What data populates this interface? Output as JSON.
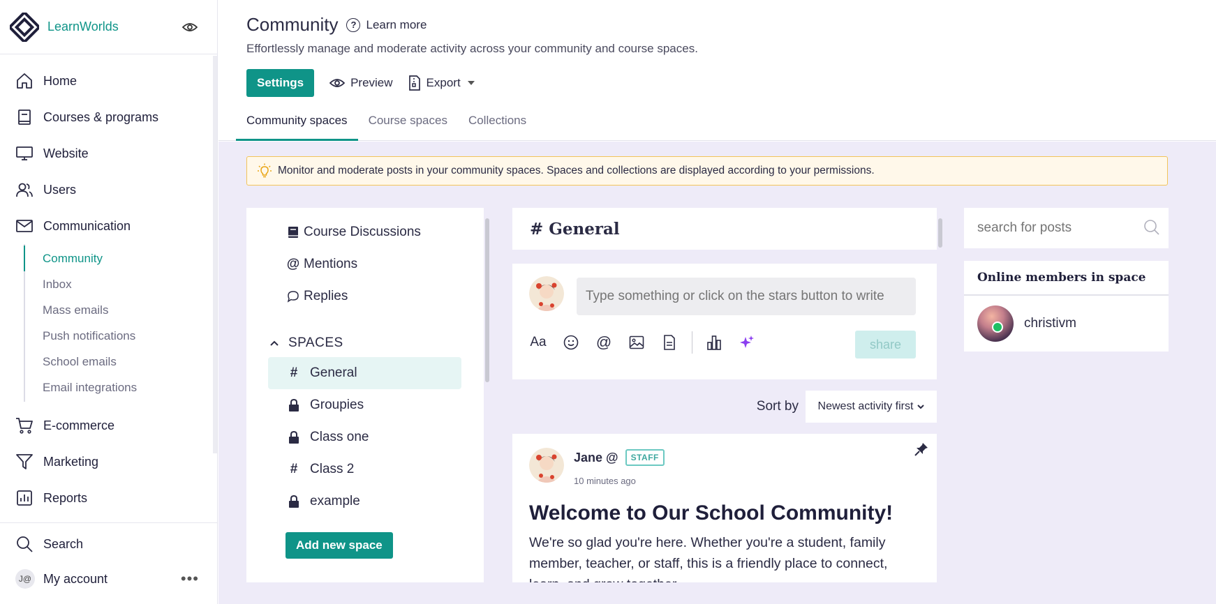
{
  "brand": {
    "name": "LearnWorlds"
  },
  "nav": {
    "home": "Home",
    "courses": "Courses & programs",
    "website": "Website",
    "users": "Users",
    "communication": "Communication",
    "sub": [
      "Community",
      "Inbox",
      "Mass emails",
      "Push notifications",
      "School emails",
      "Email integrations"
    ],
    "ecommerce": "E-commerce",
    "marketing": "Marketing",
    "reports": "Reports",
    "search": "Search",
    "account": "My account",
    "account_initials": "J@"
  },
  "header": {
    "title": "Community",
    "learn_more": "Learn more",
    "subtitle": "Effortlessly manage and moderate activity across your community and course spaces.",
    "settings": "Settings",
    "preview": "Preview",
    "export": "Export",
    "tabs": [
      "Community spaces",
      "Course spaces",
      "Collections"
    ]
  },
  "notice": "Monitor and moderate posts in your community spaces. Spaces and collections are displayed according to your permissions.",
  "left_panel": {
    "items": [
      "Course Discussions",
      "Mentions",
      "Replies"
    ],
    "spaces_heading": "SPACES",
    "spaces": [
      {
        "name": "General",
        "icon": "#"
      },
      {
        "name": "Groupies",
        "icon": "lock"
      },
      {
        "name": "Class one",
        "icon": "lock"
      },
      {
        "name": "Class 2",
        "icon": "#"
      },
      {
        "name": "example",
        "icon": "lock"
      }
    ],
    "add_space": "Add new space"
  },
  "center": {
    "space_title": "# General",
    "composer_placeholder": "Type something or click on the stars button to write",
    "share": "share",
    "sort_label": "Sort by",
    "sort_value": "Newest activity first",
    "post": {
      "author": "Jane @",
      "badge": "STAFF",
      "time": "10 minutes ago",
      "title": "Welcome to Our School Community!",
      "body": "We're so glad you're here. Whether you're a student, family member, teacher, or staff, this is a friendly place to connect, learn, and grow together."
    }
  },
  "right_panel": {
    "search_placeholder": "search for posts",
    "online_title": "Online members in space",
    "members": [
      "christivm"
    ]
  },
  "colors": {
    "accent": "#0f9488",
    "background": "#eeebf8",
    "notice_border": "#f2c45a"
  }
}
